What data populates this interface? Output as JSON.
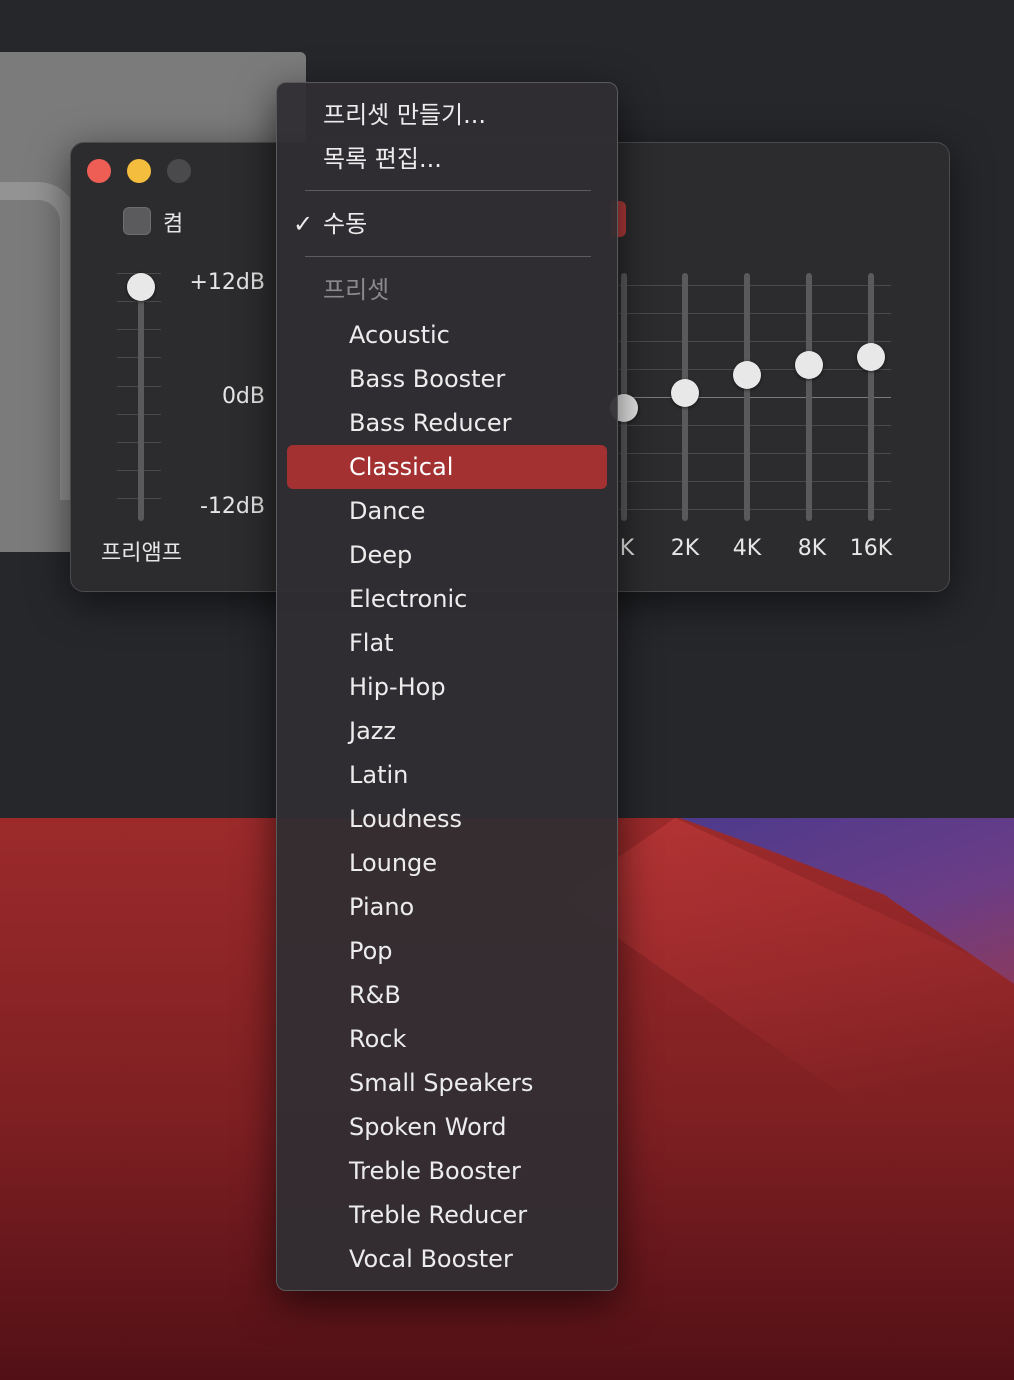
{
  "eq_window": {
    "toggle_label": "켬",
    "db_top": "+12dB",
    "db_mid": "0dB",
    "db_bottom": "-12dB",
    "preamp_label": "프리앰프",
    "band_labels": [
      "K",
      "2K",
      "4K",
      "8K",
      "16K"
    ]
  },
  "menu": {
    "create_preset": "프리셋 만들기...",
    "edit_list": "목록 편집...",
    "manual_check": "✓",
    "manual": "수동",
    "presets_header": "프리셋",
    "presets": [
      "Acoustic",
      "Bass Booster",
      "Bass Reducer",
      "Classical",
      "Dance",
      "Deep",
      "Electronic",
      "Flat",
      "Hip-Hop",
      "Jazz",
      "Latin",
      "Loudness",
      "Lounge",
      "Piano",
      "Pop",
      "R&B",
      "Rock",
      "Small Speakers",
      "Spoken Word",
      "Treble Booster",
      "Treble Reducer",
      "Vocal Booster"
    ],
    "selected_preset": "Classical"
  },
  "colors": {
    "menu_highlight": "#a33131",
    "close": "#ee5e55",
    "minimize": "#f4bd3e"
  }
}
